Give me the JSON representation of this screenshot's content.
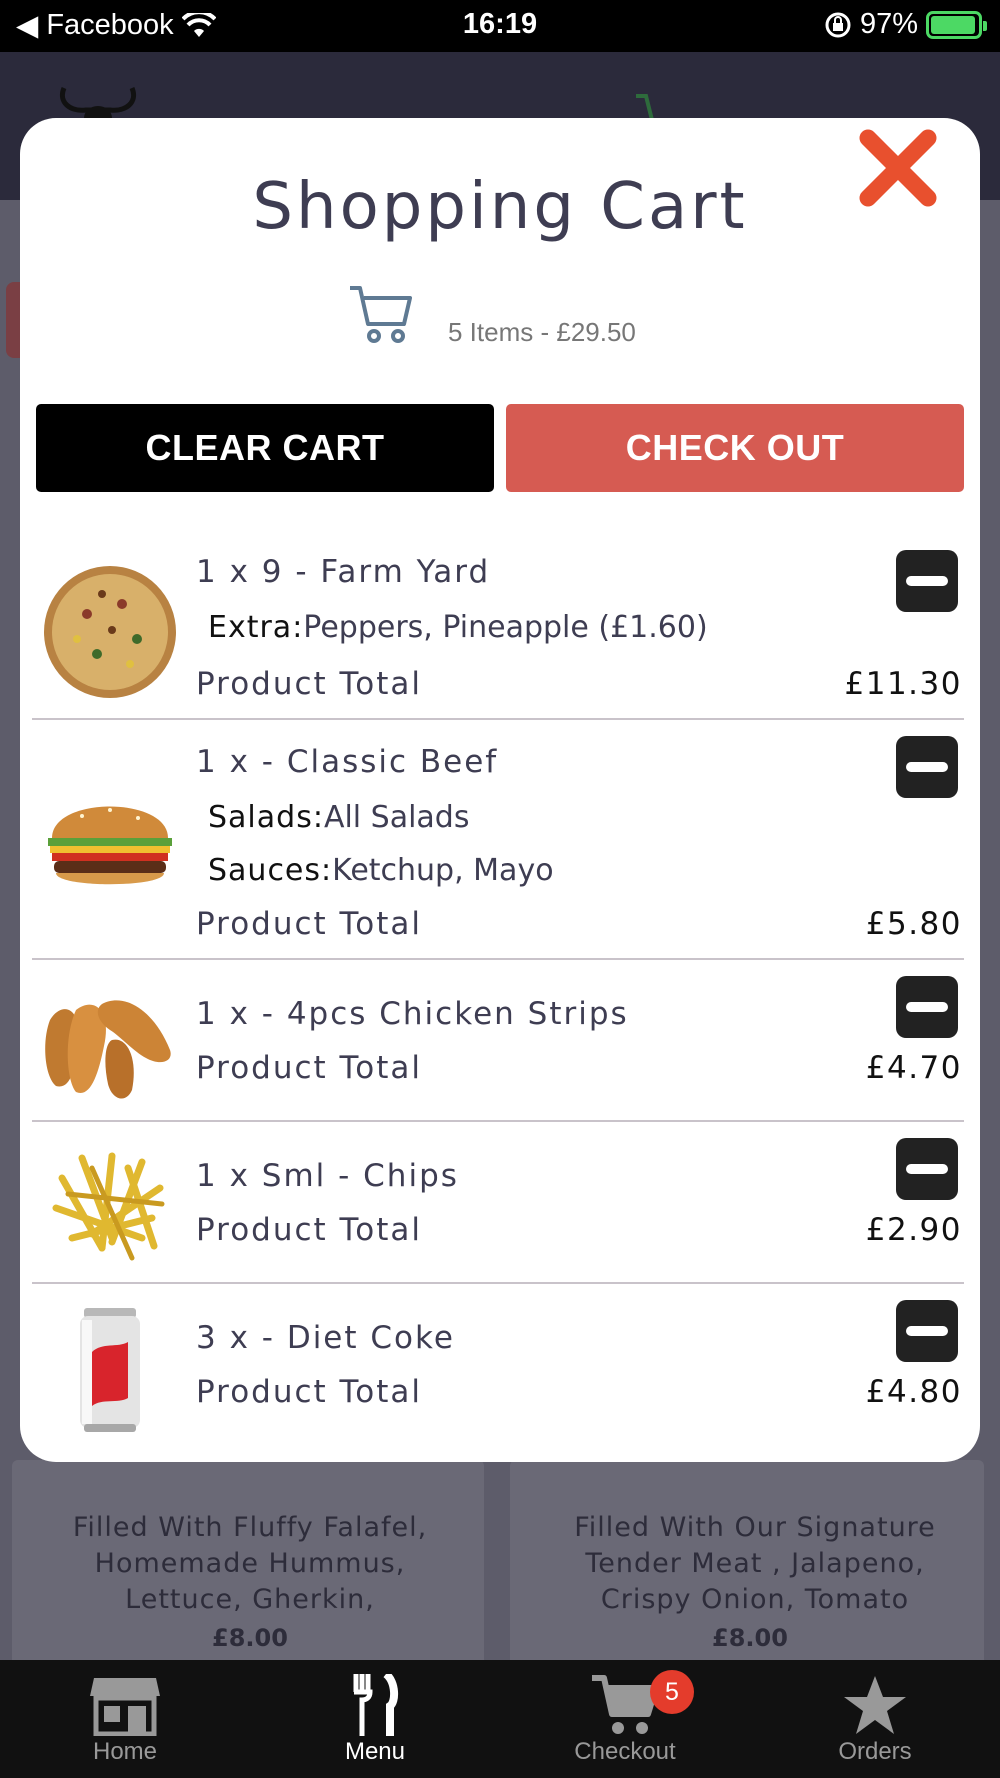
{
  "status_bar": {
    "back_app": "Facebook",
    "time": "16:19",
    "battery": "97%"
  },
  "background": {
    "cards": [
      {
        "desc": "Filled With Fluffy Falafel, Homemade Hummus, Lettuce, Gherkin,",
        "price": "£8.00"
      },
      {
        "desc": "Filled With Our Signature Tender Meat , Jalapeno, Crispy Onion, Tomato",
        "price": "£8.00"
      }
    ]
  },
  "cart": {
    "title": "Shopping Cart",
    "summary": "5 Items - £29.50",
    "clear_label": "CLEAR CART",
    "checkout_label": "CHECK OUT",
    "total_label": "Product Total",
    "items": [
      {
        "name": "1 x 9 - Farm Yard",
        "options": [
          {
            "label": "Extra:",
            "value": "Peppers, Pineapple (£1.60)"
          }
        ],
        "total": "£11.30",
        "image": "pizza"
      },
      {
        "name": "1 x - Classic Beef",
        "options": [
          {
            "label": "Salads:",
            "value": "All Salads"
          },
          {
            "label": "Sauces:",
            "value": "Ketchup, Mayo"
          }
        ],
        "total": "£5.80",
        "image": "burger"
      },
      {
        "name": "1 x - 4pcs Chicken Strips",
        "options": [],
        "total": "£4.70",
        "image": "chicken-strips"
      },
      {
        "name": "1 x Sml - Chips",
        "options": [],
        "total": "£2.90",
        "image": "chips"
      },
      {
        "name": "3 x - Diet Coke",
        "options": [],
        "total": "£4.80",
        "image": "diet-coke-can"
      }
    ]
  },
  "tabbar": {
    "tabs": [
      {
        "label": "Home",
        "icon": "store-icon"
      },
      {
        "label": "Menu",
        "icon": "cutlery-icon"
      },
      {
        "label": "Checkout",
        "icon": "cart-icon",
        "badge": "5"
      },
      {
        "label": "Orders",
        "icon": "star-icon"
      }
    ],
    "active": "Menu"
  },
  "colors": {
    "checkout": "#d65b52",
    "close": "#e8502e",
    "badge": "#e43c2c",
    "title": "#3e3d52"
  }
}
